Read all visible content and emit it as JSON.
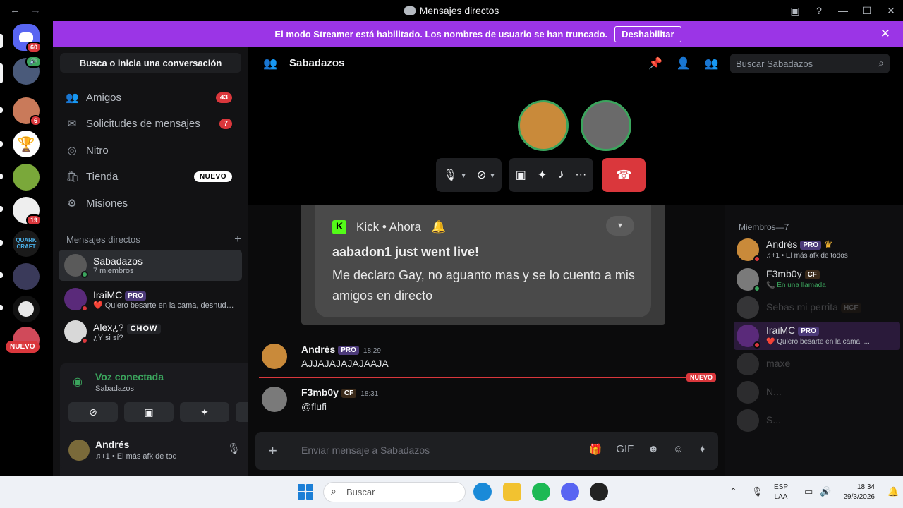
{
  "window": {
    "title": "Mensajes directos",
    "back_icon": "←",
    "forward_icon": "→"
  },
  "streamer_banner": {
    "text": "El modo Streamer está habilitado. Los nombres de usuario se han truncado.",
    "button": "Deshabilitar"
  },
  "guilds": {
    "dm_badge": "60",
    "items": [
      {
        "badge": "6",
        "label": ""
      },
      {
        "badge": "",
        "label": ""
      },
      {
        "badge": "",
        "label": ""
      },
      {
        "badge": "19",
        "label": ""
      },
      {
        "badge": "",
        "label": "QUARK CRAFT"
      }
    ],
    "nuevo": "NUEVO"
  },
  "dm_sidebar": {
    "search_placeholder": "Busca o inicia una conversación",
    "nav": [
      {
        "label": "Amigos",
        "count": "43"
      },
      {
        "label": "Solicitudes de mensajes",
        "count": "7"
      },
      {
        "label": "Nitro",
        "count": ""
      },
      {
        "label": "Tienda",
        "badge": "NUEVO"
      },
      {
        "label": "Misiones",
        "count": ""
      }
    ],
    "dm_header": "Mensajes directos",
    "dms": [
      {
        "name": "Sabadazos",
        "sub": "7 miembros"
      },
      {
        "name": "IraiMC",
        "tag": "PRO",
        "sub": "❤️ Quiero besarte en la cama, desnuda o..."
      },
      {
        "name": "Alex¿?",
        "tag": "CHOW",
        "sub": "¿Y si sí?"
      }
    ]
  },
  "voice": {
    "title": "Voz conectada",
    "channel": "Sabadazos"
  },
  "user": {
    "name": "Andrés",
    "status": "♫+1 • El más afk de tod"
  },
  "channel": {
    "name": "Sabadazos",
    "search_placeholder": "Buscar Sabadazos"
  },
  "notification": {
    "app": "Kick • Ahora",
    "title": "aabadon1 just went live!",
    "body": "Me declaro Gay, no aguanto mas y se lo cuento a mis amigos en directo"
  },
  "messages": [
    {
      "author": "Andrés",
      "tag": "PRO",
      "time": "18:29",
      "text": "AJJAJAJAJAJAAJA"
    },
    {
      "author": "F3mb0y",
      "tag": "CF",
      "time": "18:31",
      "text": "@flufi"
    }
  ],
  "new_divider": "NUEVO",
  "composer": {
    "placeholder": "Enviar mensaje a Sabadazos"
  },
  "members": {
    "header": "Miembros—7",
    "list": [
      {
        "name": "Andrés",
        "tag": "PRO",
        "sub": "♫+1 • El más afk de todos"
      },
      {
        "name": "F3mb0y",
        "tag": "CF",
        "sub": "📞 En una llamada"
      },
      {
        "name": "Sebas mi perrita",
        "tag": "HCF",
        "sub": ""
      },
      {
        "name": "IraiMC",
        "tag": "PRO",
        "sub": "❤️ Quiero besarte en la cama, ..."
      },
      {
        "name": "maxe",
        "tag": "",
        "sub": ""
      },
      {
        "name": "N...",
        "tag": "",
        "sub": ""
      },
      {
        "name": "S...",
        "tag": "",
        "sub": ""
      }
    ]
  },
  "taskbar": {
    "search": "Buscar",
    "lang1": "ESP",
    "lang2": "LAA",
    "time": "18:34",
    "date": "29/3/2026"
  },
  "colors": {
    "accent_purple": "#9b35e6",
    "danger": "#da373c",
    "online": "#3ba55d"
  }
}
